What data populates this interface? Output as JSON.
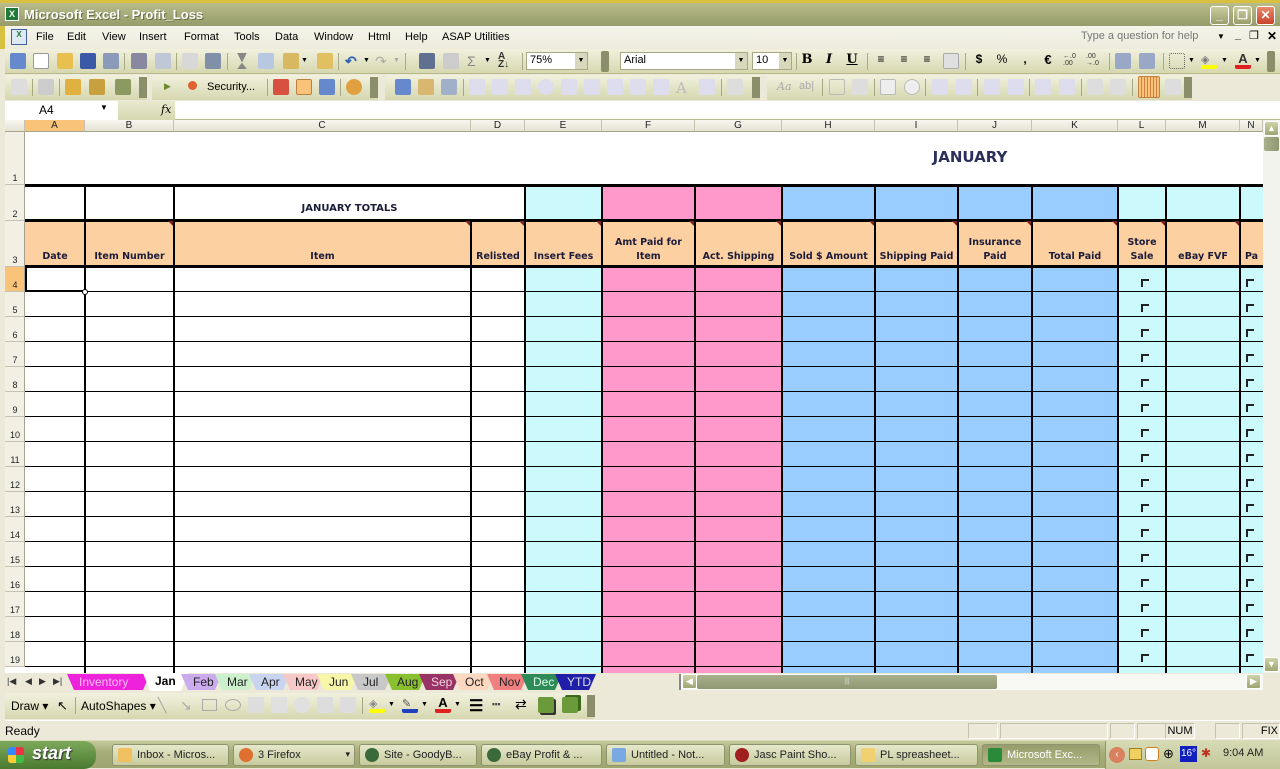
{
  "window": {
    "title": "Microsoft Excel - Profit_Loss",
    "controls": [
      "minimize",
      "restore",
      "close"
    ]
  },
  "menubar": {
    "items": [
      "File",
      "Edit",
      "View",
      "Insert",
      "Format",
      "Tools",
      "Data",
      "Window",
      "Html",
      "Help",
      "ASAP Utilities"
    ],
    "help_placeholder": "Type a question for help"
  },
  "toolbar": {
    "zoom": "75%",
    "font": "Arial",
    "font_size": "10",
    "bold": "B",
    "italic": "I",
    "underline": "U",
    "currency": "$",
    "percent": "%",
    "comma": ",",
    "euro": "€",
    "security_label": "Security..."
  },
  "formula_bar": {
    "name_box": "A4",
    "fx": "fx",
    "content": ""
  },
  "columns": [
    "A",
    "B",
    "C",
    "D",
    "E",
    "F",
    "G",
    "H",
    "I",
    "J",
    "K",
    "L",
    "M",
    "N"
  ],
  "selected_cell": "A4",
  "sheet": {
    "title": "JANUARY",
    "totals_label": "JANUARY TOTALS",
    "headers": [
      "Date",
      "Item Number",
      "Item",
      "Relisted",
      "Insert Fees",
      "Amt Paid for Item",
      "Act. Shipping",
      "Sold  $ Amount",
      "Shipping Paid",
      "Insurance Paid",
      "Total Paid",
      "Store Sale",
      "eBay FVF",
      "Pa"
    ],
    "rows": [
      "4",
      "5",
      "6",
      "7",
      "8",
      "9",
      "10",
      "11",
      "12",
      "13",
      "14",
      "15",
      "16",
      "17",
      "18",
      "19"
    ],
    "row_labels_top": [
      "1",
      "2",
      "3"
    ],
    "colors": {
      "header": "#fcd0a0",
      "cyan": "#ccf9fb",
      "pink": "#ff99cc",
      "blue": "#99ccff"
    }
  },
  "sheet_tabs": [
    {
      "label": "Inventory",
      "color": "#ee22dd",
      "text": "#f9c0f0"
    },
    {
      "label": "Jan",
      "color": "#ffffff",
      "text": "#000000",
      "active": true
    },
    {
      "label": "Feb",
      "color": "#ccaaee",
      "text": "#222"
    },
    {
      "label": "Mar",
      "color": "#ccf0cc",
      "text": "#222"
    },
    {
      "label": "Apr",
      "color": "#c8d4f0",
      "text": "#222"
    },
    {
      "label": "May",
      "color": "#f6c8c8",
      "text": "#222"
    },
    {
      "label": "Jun",
      "color": "#f8f6a8",
      "text": "#222"
    },
    {
      "label": "Jul",
      "color": "#c8c8c8",
      "text": "#222"
    },
    {
      "label": "Aug",
      "color": "#88c030",
      "text": "#222"
    },
    {
      "label": "Sep",
      "color": "#993366",
      "text": "#f0d0e0"
    },
    {
      "label": "Oct",
      "color": "#fcd8c0",
      "text": "#222"
    },
    {
      "label": "Nov",
      "color": "#f08080",
      "text": "#222"
    },
    {
      "label": "Dec",
      "color": "#2e8b57",
      "text": "#dfe"
    },
    {
      "label": "YTD",
      "color": "#1f1fa8",
      "text": "#dde"
    }
  ],
  "drawbar": {
    "draw": "Draw",
    "autoshapes": "AutoShapes"
  },
  "status": {
    "ready": "Ready",
    "num": "NUM",
    "fix": "FIX"
  },
  "taskbar": {
    "start": "start",
    "tasks": [
      {
        "label": "Inbox - Micros...",
        "icon": "outlook-icon"
      },
      {
        "label": "3 Firefox",
        "icon": "firefox-icon"
      },
      {
        "label": "Site - GoodyB...",
        "icon": "globe-icon"
      },
      {
        "label": "eBay Profit & ...",
        "icon": "globe-icon"
      },
      {
        "label": "Untitled - Not...",
        "icon": "notepad-icon"
      },
      {
        "label": "Jasc Paint Sho...",
        "icon": "paint-icon"
      },
      {
        "label": "PL spreasheet...",
        "icon": "folder-icon"
      },
      {
        "label": "Microsoft Exc...",
        "icon": "excel-icon",
        "active": true
      }
    ],
    "tray_temp": "16°",
    "clock": "9:04 AM"
  }
}
